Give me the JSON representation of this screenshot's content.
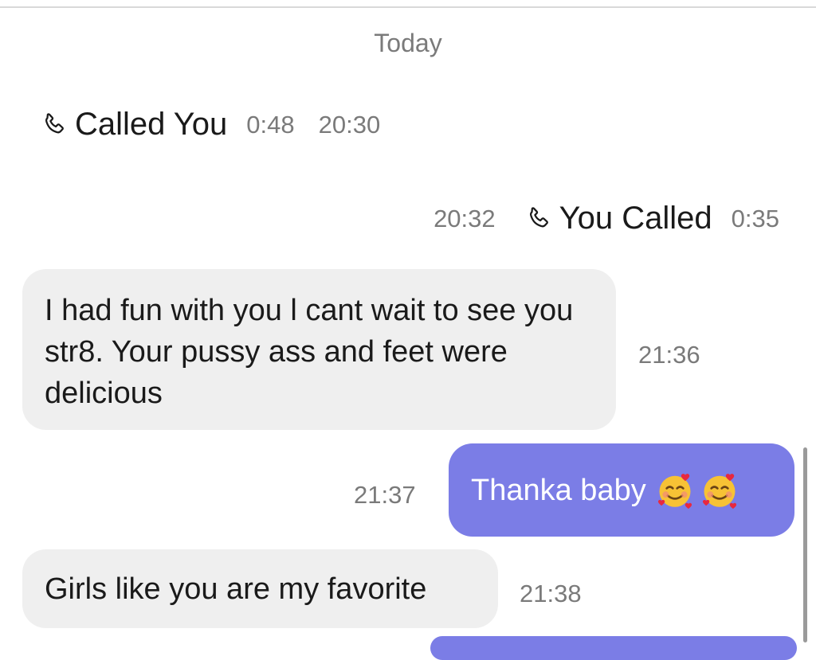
{
  "date_separator": "Today",
  "calls": [
    {
      "direction": "incoming",
      "label": "Called You",
      "duration": "0:48",
      "time": "20:30"
    },
    {
      "direction": "outgoing",
      "label": "You Called",
      "duration": "0:35",
      "time": "20:32"
    }
  ],
  "messages": [
    {
      "side": "incoming",
      "text": "I had fun with you l cant wait to see you str8. Your pussy ass and feet were delicious",
      "time": "21:36"
    },
    {
      "side": "outgoing",
      "text": "Thanka baby",
      "emojis": [
        "smiling-face-with-hearts-icon",
        "smiling-face-with-hearts-icon"
      ],
      "time": "21:37"
    },
    {
      "side": "incoming",
      "text": "Girls like you are my favorite",
      "time": "21:38"
    }
  ],
  "colors": {
    "outgoing_bubble": "#7b7de6",
    "incoming_bubble": "#efefef",
    "timestamp": "#7a7a7a"
  }
}
